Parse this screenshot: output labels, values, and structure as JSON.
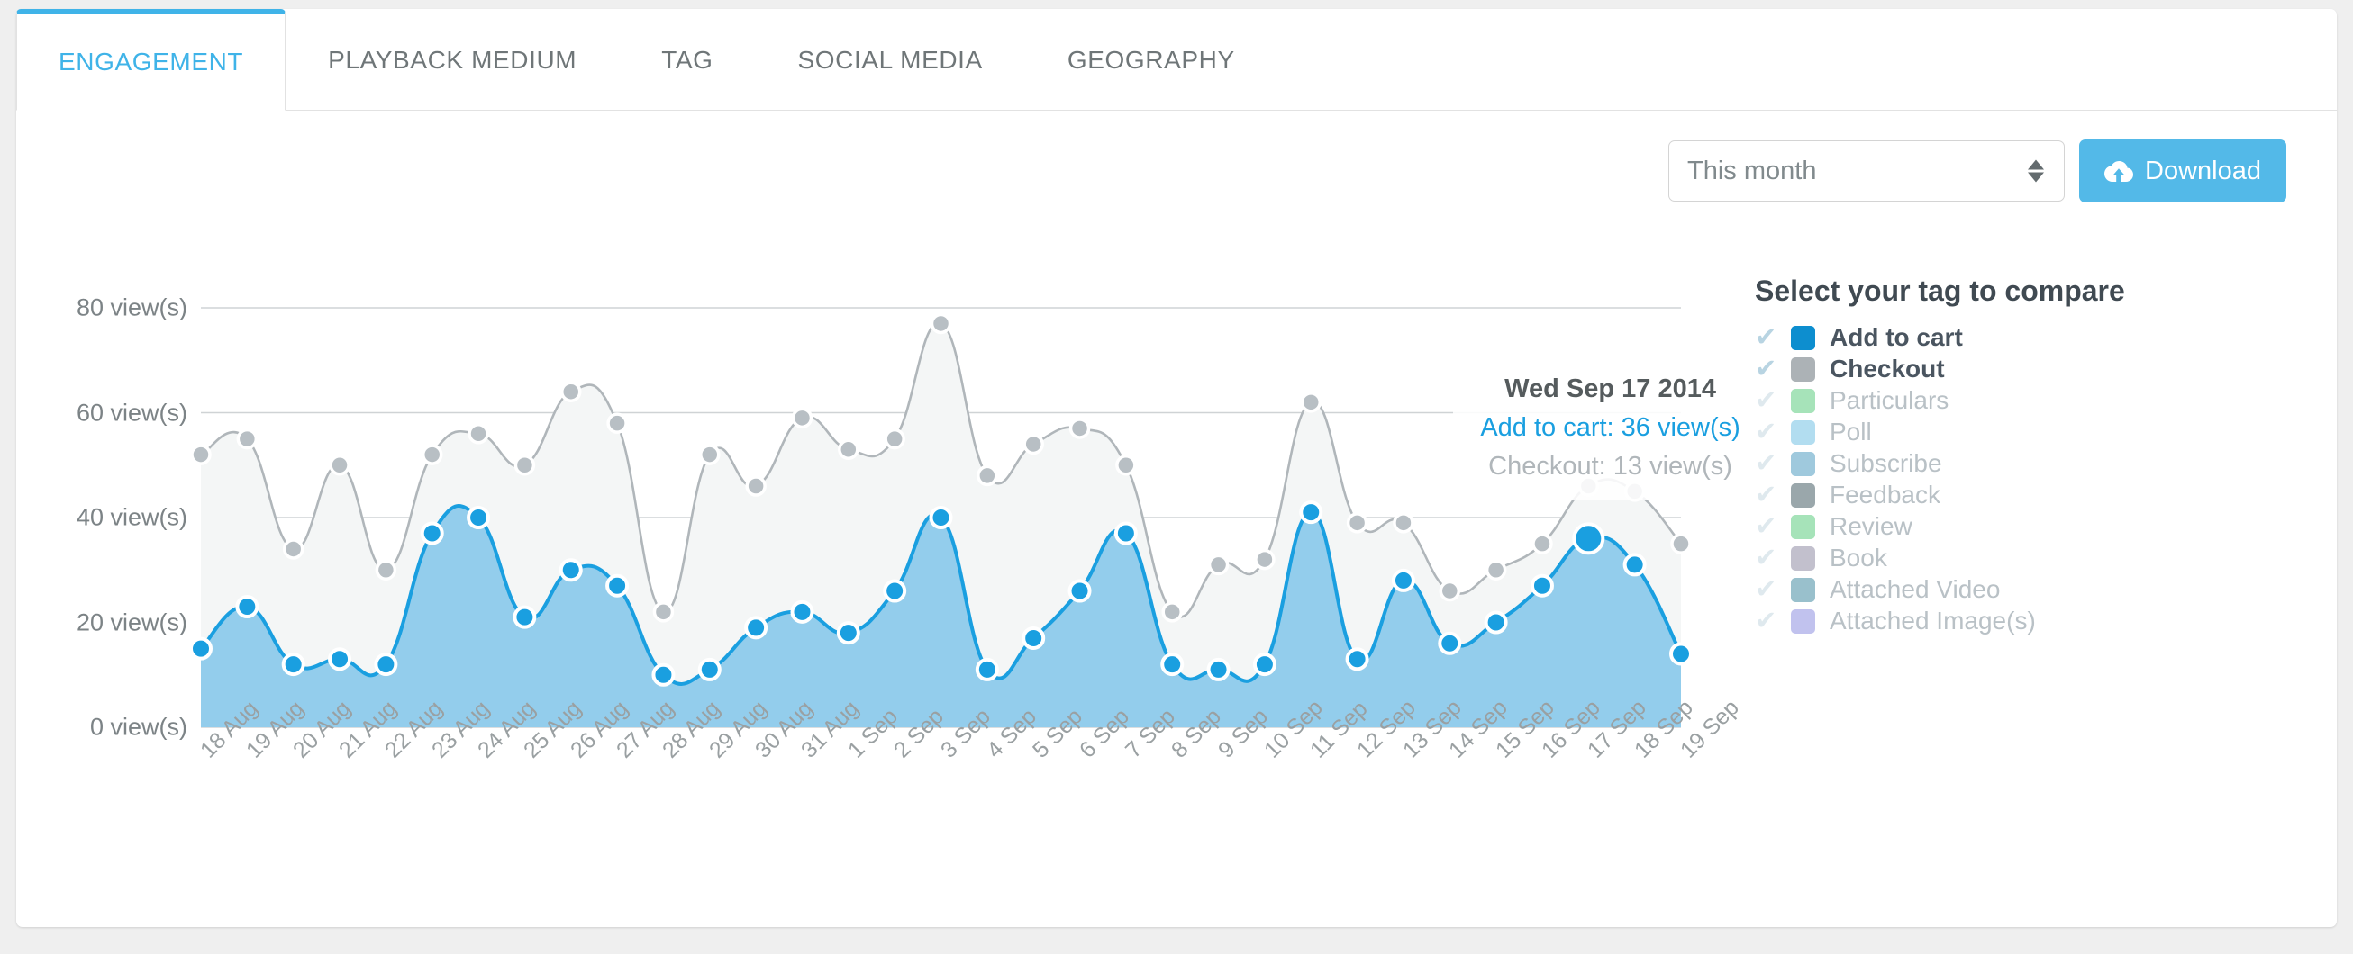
{
  "tabs": [
    {
      "label": "ENGAGEMENT",
      "active": true
    },
    {
      "label": "PLAYBACK MEDIUM",
      "active": false
    },
    {
      "label": "TAG",
      "active": false
    },
    {
      "label": "SOCIAL MEDIA",
      "active": false
    },
    {
      "label": "GEOGRAPHY",
      "active": false
    }
  ],
  "controls": {
    "period_select_value": "This month",
    "download_label": "Download",
    "download_icon": "cloud-download-icon"
  },
  "legend": {
    "title": "Select your tag to compare",
    "check_icon": "check-icon",
    "items": [
      {
        "label": "Add to cart",
        "color": "#0d8ecf",
        "active": true
      },
      {
        "label": "Checkout",
        "color": "#acb2b6",
        "active": true
      },
      {
        "label": "Particulars",
        "color": "#a6e3b9",
        "active": false
      },
      {
        "label": "Poll",
        "color": "#b2ddf0",
        "active": false
      },
      {
        "label": "Subscribe",
        "color": "#9fc9dd",
        "active": false
      },
      {
        "label": "Feedback",
        "color": "#9aa7ab",
        "active": false
      },
      {
        "label": "Review",
        "color": "#a6e3b9",
        "active": false
      },
      {
        "label": "Book",
        "color": "#c2c0cd",
        "active": false
      },
      {
        "label": "Attached Video",
        "color": "#99c0cc",
        "active": false
      },
      {
        "label": "Attached Image(s)",
        "color": "#c1c2ee",
        "active": false
      }
    ]
  },
  "tooltip": {
    "title": "Wed Sep 17 2014",
    "rows": [
      {
        "text": "Add to cart: 36 view(s)",
        "color": "#1a9fe0"
      },
      {
        "text": "Checkout: 13 view(s)",
        "color": "#b0b6ba"
      }
    ]
  },
  "chart_data": {
    "type": "area",
    "title": "",
    "xlabel": "",
    "ylabel": "view(s)",
    "ylim": [
      0,
      80
    ],
    "yticks": [
      0,
      20,
      40,
      60,
      80
    ],
    "ytick_labels": [
      "0 view(s)",
      "20 view(s)",
      "40 view(s)",
      "60 view(s)",
      "80 view(s)"
    ],
    "grid": true,
    "legend_position": "right",
    "highlight": {
      "category": "17 Sep",
      "series": "Add to cart",
      "value": 36
    },
    "categories": [
      "18 Aug",
      "19 Aug",
      "20 Aug",
      "21 Aug",
      "22 Aug",
      "23 Aug",
      "24 Aug",
      "25 Aug",
      "26 Aug",
      "27 Aug",
      "28 Aug",
      "29 Aug",
      "30 Aug",
      "31 Aug",
      "1 Sep",
      "2 Sep",
      "3 Sep",
      "4 Sep",
      "5 Sep",
      "6 Sep",
      "7 Sep",
      "8 Sep",
      "9 Sep",
      "10 Sep",
      "11 Sep",
      "12 Sep",
      "13 Sep",
      "14 Sep",
      "15 Sep",
      "16 Sep",
      "17 Sep",
      "18 Sep",
      "19 Sep"
    ],
    "series": [
      {
        "name": "Add to cart",
        "color": "#1a9fe0",
        "fill": "#93cdec",
        "values": [
          15,
          23,
          12,
          13,
          12,
          37,
          40,
          21,
          30,
          27,
          10,
          11,
          19,
          22,
          18,
          26,
          40,
          11,
          17,
          26,
          37,
          12,
          11,
          12,
          41,
          13,
          28,
          16,
          20,
          27,
          36,
          31,
          14
        ]
      },
      {
        "name": "Checkout",
        "color": "#b0b6ba",
        "fill": "#f4f6f6",
        "values": [
          52,
          55,
          34,
          50,
          30,
          52,
          56,
          50,
          64,
          58,
          22,
          52,
          46,
          59,
          53,
          55,
          77,
          48,
          54,
          57,
          50,
          22,
          31,
          32,
          62,
          39,
          39,
          26,
          30,
          35,
          46,
          45,
          35
        ]
      }
    ]
  }
}
